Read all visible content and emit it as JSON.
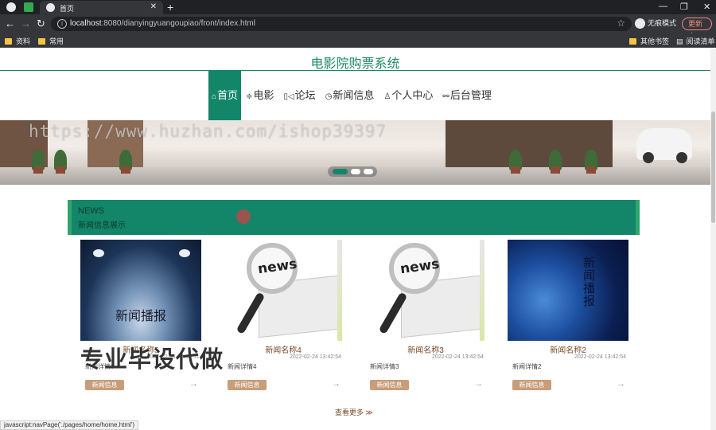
{
  "browser": {
    "tab_title": "首页",
    "url_host": "localhost",
    "url_rest": ":8080/dianyingyuangoupiao/front/index.html",
    "incognito_label": "无痕模式",
    "update_label": "更新",
    "bookmarks_left": [
      "资料",
      "常用"
    ],
    "bookmarks_right": [
      "其他书签",
      "阅读清单"
    ],
    "status_url": "javascript:navPage('./pages/home/home.html')"
  },
  "site": {
    "title": "电影院购票系统",
    "accent_color": "#13866a"
  },
  "nav": {
    "items": [
      {
        "icon": "home-icon",
        "label": "首页"
      },
      {
        "icon": "filter-icon",
        "label": "电影"
      },
      {
        "icon": "forum-icon",
        "label": "论坛"
      },
      {
        "icon": "clock-icon",
        "label": "新闻信息"
      },
      {
        "icon": "user-icon",
        "label": "个人中心"
      },
      {
        "icon": "link-icon",
        "label": "后台管理"
      }
    ]
  },
  "banner": {
    "watermark": "https://www.huzhan.com/ishop39397"
  },
  "news": {
    "title_en": "NEWS",
    "title_cn": "新闻信息展示",
    "cards": [
      {
        "name": "新闻名称5",
        "time": "2022-02-24 13:42:54",
        "detail": "新闻详情5",
        "badge": "新闻信息",
        "image_text": "新闻播报"
      },
      {
        "name": "新闻名称4",
        "time": "2022-02-24 13:42:54",
        "detail": "新闻详情4",
        "badge": "新闻信息",
        "image_text": "news"
      },
      {
        "name": "新闻名称3",
        "time": "2022-02-24 13:42:54",
        "detail": "新闻详情3",
        "badge": "新闻信息",
        "image_text": "news"
      },
      {
        "name": "新闻名称2",
        "time": "2022-02-24 13:42:54",
        "detail": "新闻详情2",
        "badge": "新闻信息",
        "image_text": "新闻播报"
      }
    ],
    "more_label": "查看更多 ≫",
    "arrow": "→"
  },
  "overlay": {
    "promo_text": "专业毕设代做"
  }
}
